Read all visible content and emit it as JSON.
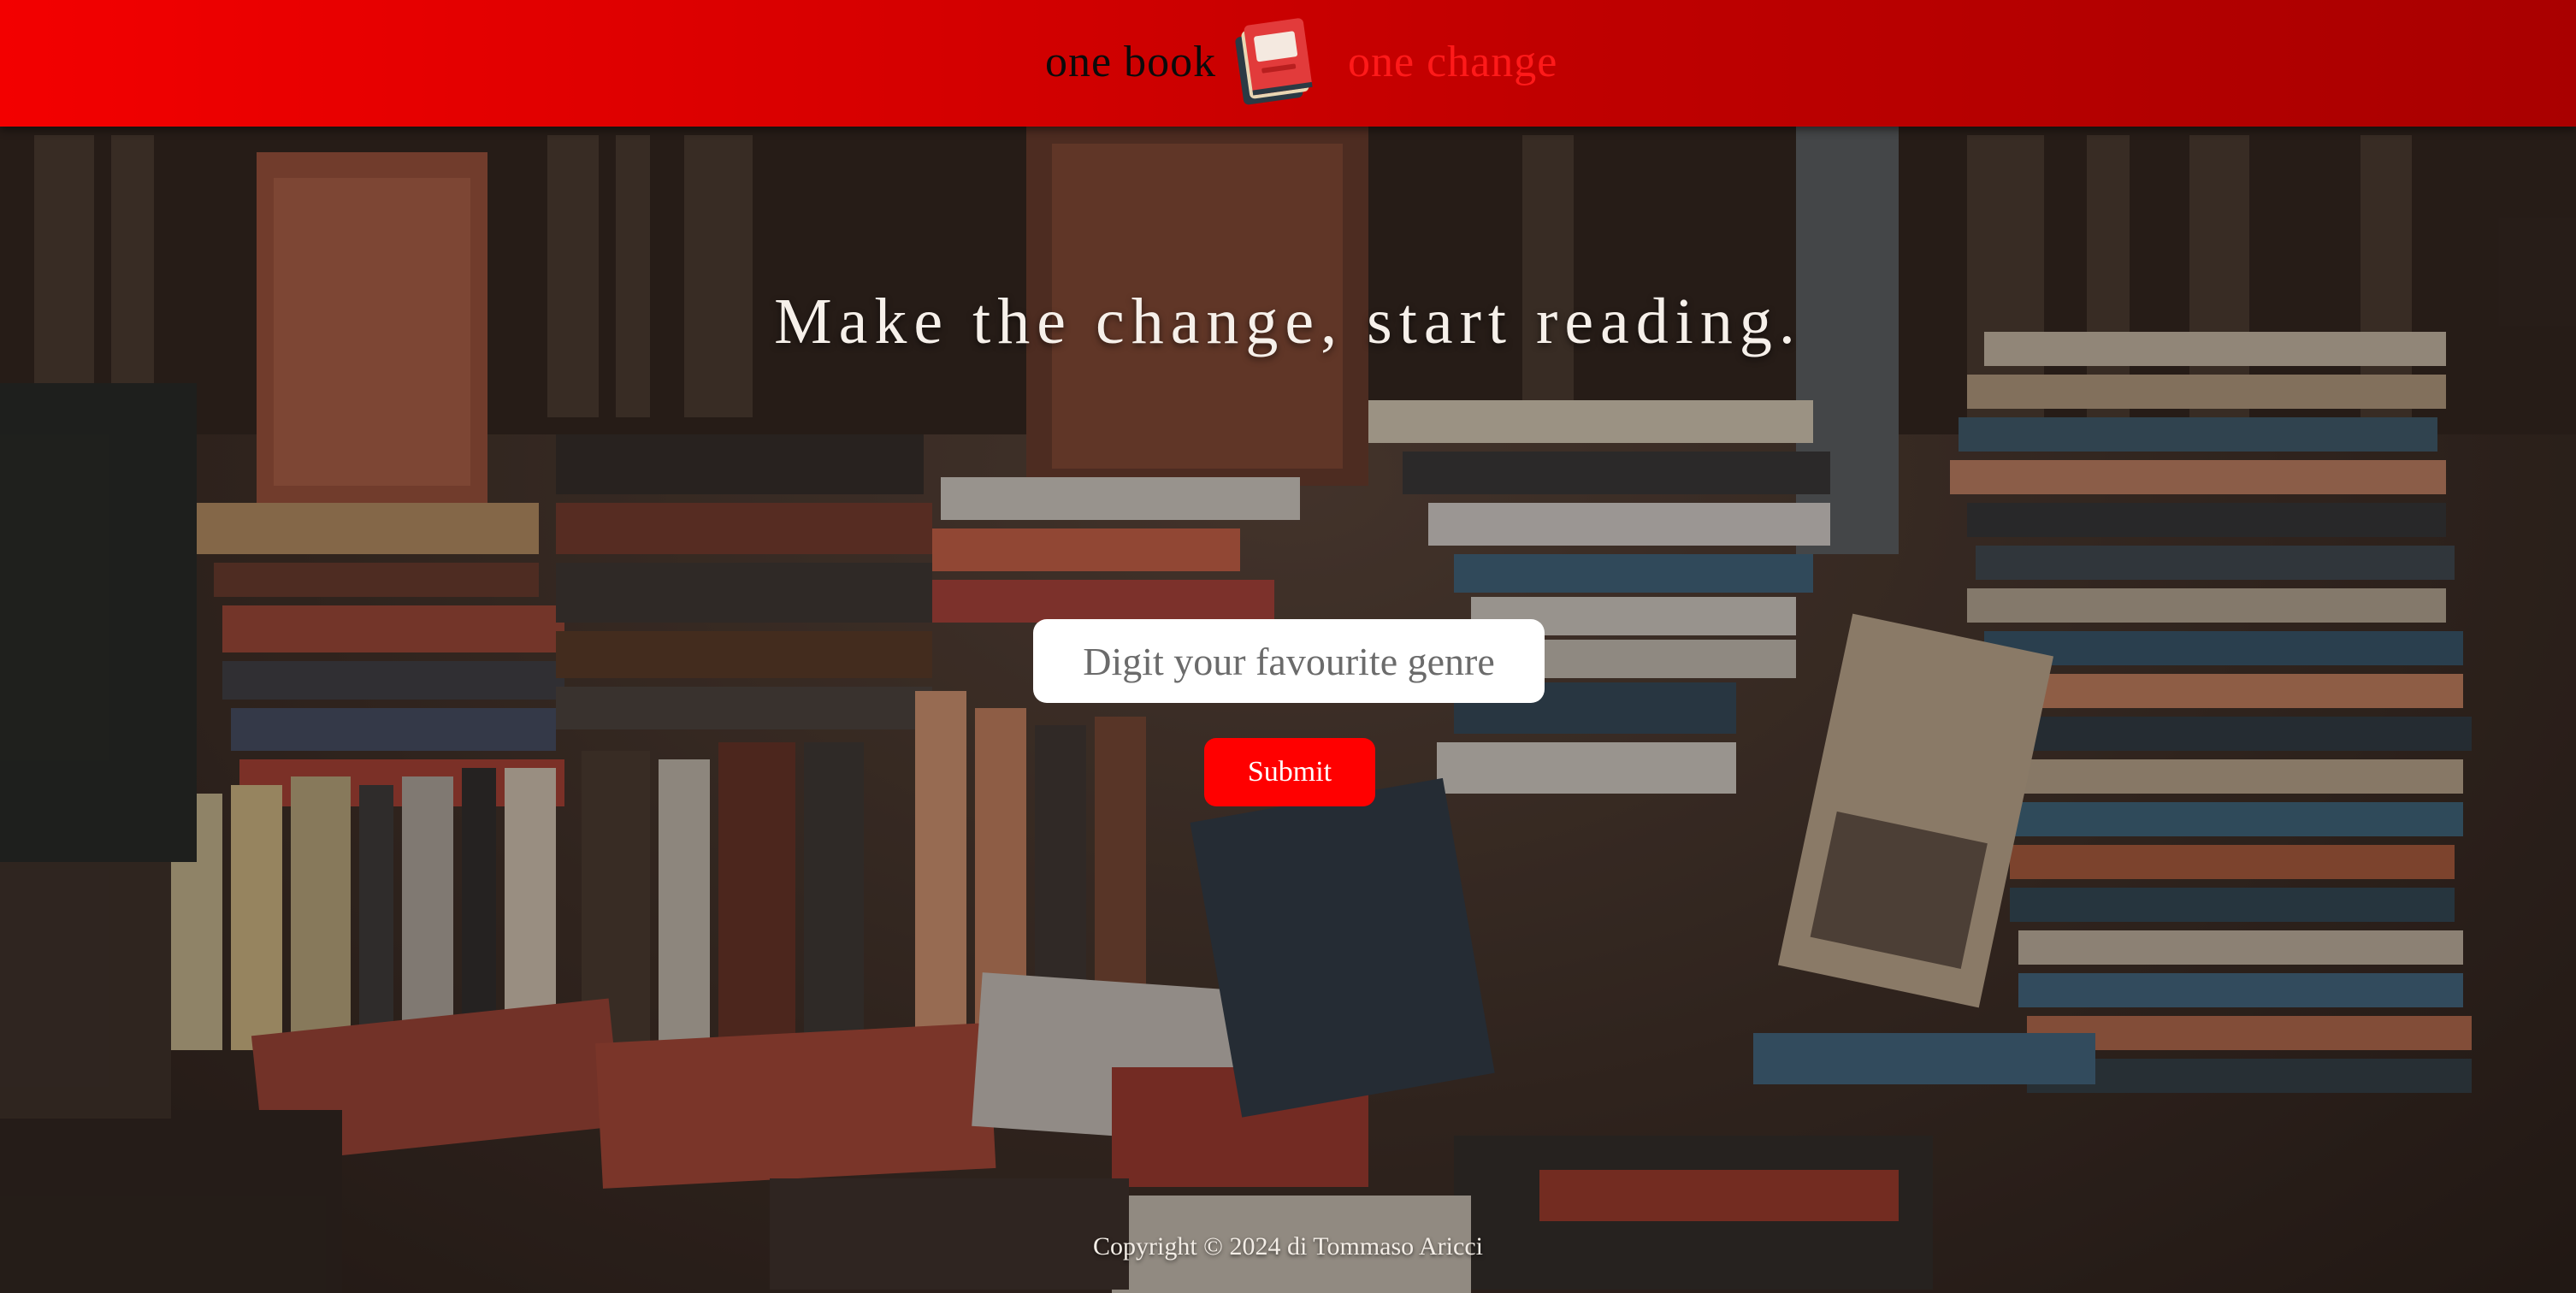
{
  "header": {
    "brand_left": "one book",
    "brand_right": "one change",
    "logo_icon": "book-stack-icon",
    "background_color": "#e00000",
    "brand_right_color": "#ff1a1a"
  },
  "hero": {
    "title": "Make the change, start reading.",
    "background_image": "bookstore-photo"
  },
  "search": {
    "placeholder": "Digit your favourite genre",
    "value": ""
  },
  "form": {
    "submit_label": "Submit",
    "submit_color": "#ff0000"
  },
  "footer": {
    "copyright": "Copyright © 2024 di Tommaso Aricci"
  }
}
